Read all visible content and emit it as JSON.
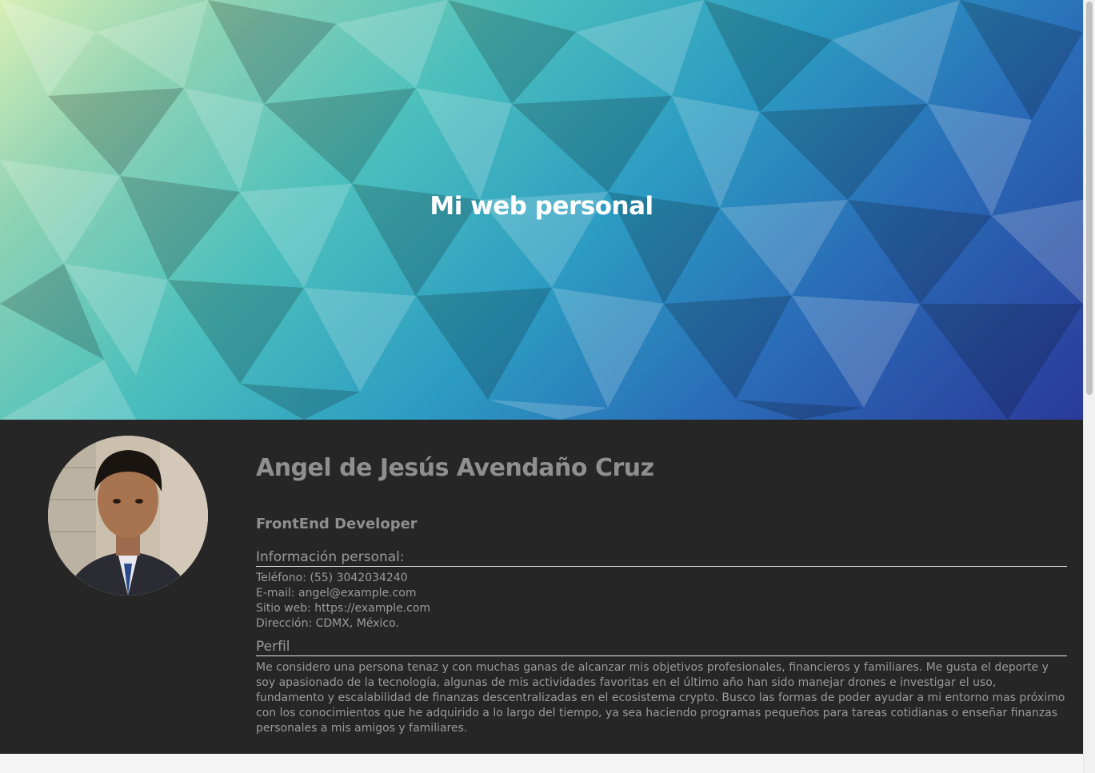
{
  "hero": {
    "title": "Mi web personal"
  },
  "profile": {
    "photo_icon": "person-photo",
    "name": "Angel de Jesús Avendaño Cruz",
    "role": "FrontEnd Developer",
    "personal_info": {
      "heading": "Información personal:",
      "phone": "Teléfono: (55) 3042034240",
      "email": "E-mail: angel@example.com",
      "website": "Sitio web: https://example.com",
      "address": "Dirección: CDMX, México."
    },
    "perfil": {
      "heading": "Perfil",
      "text": "Me considero una persona tenaz y con muchas ganas de alcanzar mis objetivos profesionales, financieros y familiares. Me gusta el deporte y soy apasionado de la tecnología, algunas de mis actividades favoritas en el último año han sido manejar drones e investigar el uso, fundamento y escalabilidad de finanzas descentralizadas en el ecosistema crypto. Busco las formas de poder ayudar a mi entorno mas próximo con los conocimientos que he adquirido a lo largo del tiempo, ya sea haciendo programas pequeños para tareas cotidianas o enseñar finanzas personales a mis amigos y familiares."
    }
  },
  "colors": {
    "section_bg": "#262626",
    "text": "#8f8f8f",
    "hero_title": "#ffffff"
  }
}
